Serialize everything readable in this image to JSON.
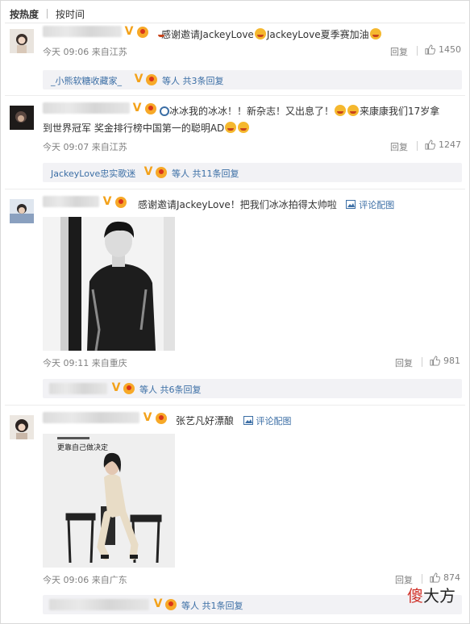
{
  "sort": {
    "hot": "按热度",
    "time": "按时间"
  },
  "comments": [
    {
      "text": "感谢邀请JackeyLove",
      "text2": "JackeyLove夏季赛加油",
      "time_loc": "今天 09:06 来自江苏",
      "reply_label": "回复",
      "likes": "1450",
      "sub_name": "_小熊软糖收藏家_",
      "sub_count": "等人 共3条回复"
    },
    {
      "text_icon_label": "冰冰我的冰冰！！新杂志！又出息了！",
      "text_tail": "来康康我们17岁拿",
      "text_line2": "到世界冠军 奖金排行榜中国第一的聪明AD",
      "time_loc": "今天 09:07 来自江苏",
      "reply_label": "回复",
      "likes": "1247",
      "sub_name": "JackeyLove忠实歌迷",
      "sub_count": "等人 共11条回复"
    },
    {
      "text": "感谢邀请JackeyLove！把我们冰冰拍得太帅啦",
      "pic_label": "评论配图",
      "time_loc": "今天 09:11 来自重庆",
      "reply_label": "回复",
      "likes": "981",
      "sub_count": "等人 共6条回复"
    },
    {
      "text": "张艺凡好漂酿",
      "pic_label": "评论配图",
      "magazine_title": "更靠自己做决定",
      "time_loc": "今天 09:06 来自广东",
      "reply_label": "回复",
      "likes": "874",
      "sub_count": "等人 共1条回复"
    }
  ],
  "watermark": {
    "first": "傻",
    "rest": "大方"
  }
}
